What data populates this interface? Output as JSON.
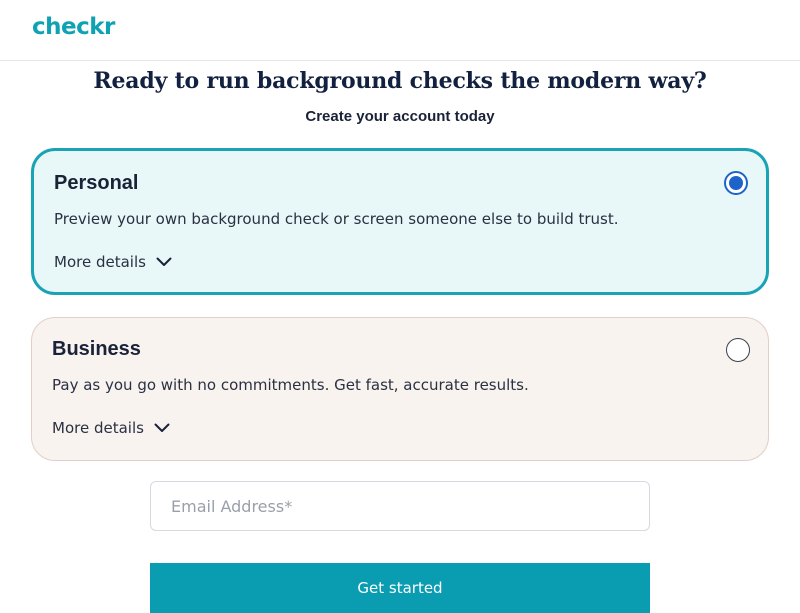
{
  "brand": {
    "logo_text": "checkr",
    "color": "#0ea2b3"
  },
  "hero": {
    "headline": "Ready to run background checks the modern way?",
    "subhead": "Create your account today"
  },
  "options": [
    {
      "title": "Personal",
      "description": "Preview your own background check or screen someone else to build trust.",
      "more_label": "More details",
      "selected": true
    },
    {
      "title": "Business",
      "description": "Pay as you go with no commitments. Get fast, accurate results.",
      "more_label": "More details",
      "selected": false
    }
  ],
  "form": {
    "email_placeholder": "Email Address*",
    "email_value": "",
    "submit_label": "Get started"
  },
  "colors": {
    "accent": "#0a9db1",
    "selected_card_bg": "#e8f7f8",
    "unselected_card_bg": "#f8f3ef",
    "radio_selected": "#1e63c9"
  },
  "icons": {
    "expand": "chevron-down-icon",
    "radio_on": "radio-selected-icon",
    "radio_off": "radio-unselected-icon"
  }
}
